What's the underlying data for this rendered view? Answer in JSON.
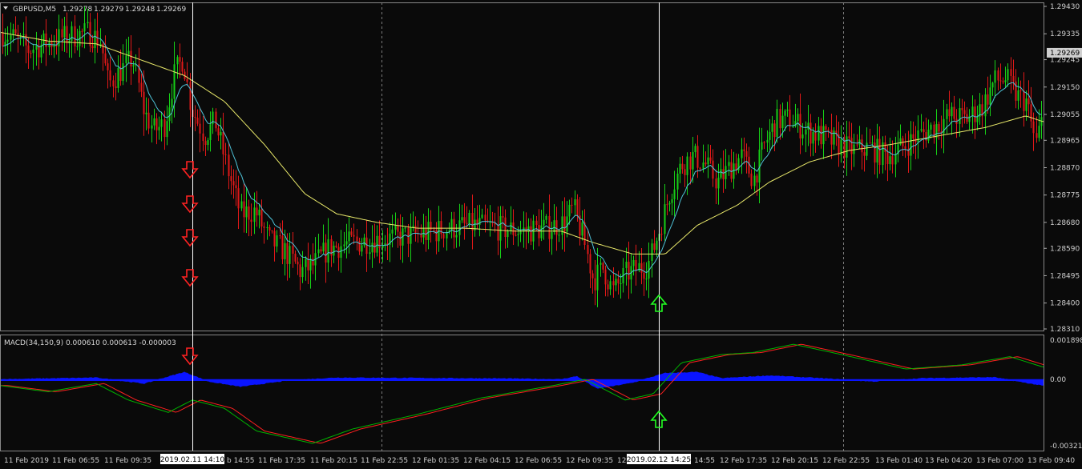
{
  "chart_data": {
    "type": "candlestick",
    "header": {
      "symbol_label": "GBPUSD,M5",
      "ohlc": [
        "1.29278",
        "1.29279",
        "1.29248",
        "1.29269"
      ],
      "current_price": "1.29269"
    },
    "price_axis": {
      "ylim": [
        1.2831,
        1.2943
      ],
      "ticks": [
        "1.29430",
        "1.29335",
        "1.29245",
        "1.29150",
        "1.29055",
        "1.28965",
        "1.28870",
        "1.28775",
        "1.28680",
        "1.28590",
        "1.28495",
        "1.28400",
        "1.28310"
      ]
    },
    "time_labels": [
      "11 Feb 2019",
      "11 Feb 06:55",
      "11 Feb 09:35",
      "b 14:55",
      "11 Feb 17:35",
      "11 Feb 20:15",
      "11 Feb 22:55",
      "12 Feb 01:35",
      "12 Feb 04:15",
      "12 Feb 06:55",
      "12 Feb 09:35",
      "12",
      "14:55",
      "12 Feb 17:35",
      "12 Feb 20:15",
      "12 Feb 22:55",
      "13 Feb 01:40",
      "13 Feb 04:20",
      "13 Feb 07:00",
      "13 Feb 09:40"
    ],
    "time_marks": [
      "2019.02.11 14:10",
      "2019.02.12 14:25"
    ],
    "price_keypoints": [
      [
        0,
        1.2934
      ],
      [
        18,
        1.2932
      ],
      [
        35,
        1.2928
      ],
      [
        55,
        1.293
      ],
      [
        75,
        1.2932
      ],
      [
        95,
        1.2933
      ],
      [
        110,
        1.2934
      ],
      [
        125,
        1.2931
      ],
      [
        135,
        1.2916
      ],
      [
        148,
        1.292
      ],
      [
        165,
        1.2925
      ],
      [
        180,
        1.2906
      ],
      [
        192,
        1.29
      ],
      [
        205,
        1.2902
      ],
      [
        218,
        1.292
      ],
      [
        228,
        1.2925
      ],
      [
        238,
        1.2908
      ],
      [
        255,
        1.2898
      ],
      [
        268,
        1.2903
      ],
      [
        285,
        1.2885
      ],
      [
        300,
        1.2871
      ],
      [
        318,
        1.2872
      ],
      [
        335,
        1.2862
      ],
      [
        355,
        1.2858
      ],
      [
        375,
        1.2851
      ],
      [
        390,
        1.2853
      ],
      [
        410,
        1.2859
      ],
      [
        440,
        1.2861
      ],
      [
        470,
        1.2862
      ],
      [
        500,
        1.2863
      ],
      [
        530,
        1.2864
      ],
      [
        560,
        1.2866
      ],
      [
        590,
        1.2867
      ],
      [
        620,
        1.2866
      ],
      [
        650,
        1.2865
      ],
      [
        680,
        1.2866
      ],
      [
        705,
        1.2868
      ],
      [
        715,
        1.2873
      ],
      [
        728,
        1.2862
      ],
      [
        740,
        1.2848
      ],
      [
        752,
        1.2852
      ],
      [
        765,
        1.2844
      ],
      [
        780,
        1.285
      ],
      [
        795,
        1.2852
      ],
      [
        808,
        1.2853
      ],
      [
        822,
        1.2865
      ],
      [
        835,
        1.2878
      ],
      [
        850,
        1.2888
      ],
      [
        865,
        1.2891
      ],
      [
        880,
        1.2888
      ],
      [
        895,
        1.2882
      ],
      [
        910,
        1.2887
      ],
      [
        925,
        1.2891
      ],
      [
        940,
        1.2883
      ],
      [
        955,
        1.2896
      ],
      [
        968,
        1.2903
      ],
      [
        985,
        1.2904
      ],
      [
        1005,
        1.29
      ],
      [
        1025,
        1.2898
      ],
      [
        1045,
        1.2895
      ],
      [
        1065,
        1.2893
      ],
      [
        1085,
        1.2894
      ],
      [
        1105,
        1.2891
      ],
      [
        1125,
        1.2894
      ],
      [
        1145,
        1.2898
      ],
      [
        1165,
        1.2901
      ],
      [
        1185,
        1.2905
      ],
      [
        1205,
        1.2904
      ],
      [
        1225,
        1.2908
      ],
      [
        1240,
        1.2917
      ],
      [
        1255,
        1.2918
      ],
      [
        1268,
        1.2912
      ],
      [
        1280,
        1.291
      ],
      [
        1292,
        1.2895
      ],
      [
        1301,
        1.2905
      ]
    ],
    "slow_ma_keypoints": [
      [
        0,
        1.2934
      ],
      [
        60,
        1.2931
      ],
      [
        120,
        1.293
      ],
      [
        170,
        1.2925
      ],
      [
        230,
        1.2919
      ],
      [
        280,
        1.291
      ],
      [
        330,
        1.2895
      ],
      [
        380,
        1.2878
      ],
      [
        420,
        1.2871
      ],
      [
        470,
        1.2868
      ],
      [
        520,
        1.2866
      ],
      [
        580,
        1.2866
      ],
      [
        640,
        1.2865
      ],
      [
        700,
        1.2865
      ],
      [
        740,
        1.2861
      ],
      [
        790,
        1.2857
      ],
      [
        830,
        1.2857
      ],
      [
        870,
        1.2867
      ],
      [
        920,
        1.2874
      ],
      [
        960,
        1.2882
      ],
      [
        1010,
        1.2889
      ],
      [
        1060,
        1.2893
      ],
      [
        1110,
        1.2895
      ],
      [
        1170,
        1.2898
      ],
      [
        1230,
        1.2901
      ],
      [
        1280,
        1.2905
      ],
      [
        1301,
        1.2903
      ]
    ],
    "macd": {
      "label": "MACD(34,150,9) 0.000610 0.000613 -0.000003",
      "ylim": [
        -0.003215,
        0.001898
      ],
      "ticks": [
        "0.001898",
        "0.00",
        "-0.003215"
      ],
      "zero_tick": "0.00",
      "main_keypoints": [
        [
          0,
          -0.0003
        ],
        [
          60,
          -0.0006
        ],
        [
          120,
          -0.0002
        ],
        [
          160,
          -0.001
        ],
        [
          210,
          -0.0016
        ],
        [
          240,
          -0.001
        ],
        [
          280,
          -0.0014
        ],
        [
          320,
          -0.0025
        ],
        [
          390,
          -0.0031
        ],
        [
          440,
          -0.0024
        ],
        [
          520,
          -0.0017
        ],
        [
          600,
          -0.0009
        ],
        [
          690,
          -0.0003
        ],
        [
          730,
          0.0
        ],
        [
          780,
          -0.001
        ],
        [
          815,
          -0.0007
        ],
        [
          850,
          0.0008
        ],
        [
          900,
          0.0012
        ],
        [
          940,
          0.0013
        ],
        [
          990,
          0.0017
        ],
        [
          1050,
          0.0012
        ],
        [
          1130,
          0.0005
        ],
        [
          1200,
          0.0007
        ],
        [
          1260,
          0.0011
        ],
        [
          1301,
          0.0006
        ]
      ],
      "histogram_keypoints": [
        [
          0,
          0.0
        ],
        [
          120,
          8e-05
        ],
        [
          180,
          -0.0002
        ],
        [
          230,
          0.00035
        ],
        [
          260,
          -0.0001
        ],
        [
          300,
          -0.00035
        ],
        [
          360,
          -5e-05
        ],
        [
          420,
          8e-05
        ],
        [
          520,
          6e-05
        ],
        [
          620,
          4e-05
        ],
        [
          700,
          0.0
        ],
        [
          720,
          0.00015
        ],
        [
          745,
          -0.00045
        ],
        [
          790,
          -0.00015
        ],
        [
          830,
          0.0003
        ],
        [
          870,
          0.00035
        ],
        [
          900,
          5e-05
        ],
        [
          960,
          0.00018
        ],
        [
          1010,
          8e-05
        ],
        [
          1090,
          -0.0001
        ],
        [
          1150,
          5e-05
        ],
        [
          1240,
          0.0001
        ],
        [
          1301,
          -0.0003
        ]
      ],
      "colors": {
        "main": "#00b400",
        "signal": "#ff2020",
        "histogram": "#0a14ff"
      }
    },
    "markers": [
      {
        "type": "sell-arrow",
        "x_mark": 0,
        "panel": "price",
        "count": 4
      },
      {
        "type": "sell-arrow",
        "x_mark": 0,
        "panel": "macd",
        "count": 1
      },
      {
        "type": "buy-arrow",
        "x_mark": 1,
        "panel": "price",
        "count": 1
      },
      {
        "type": "buy-arrow",
        "x_mark": 1,
        "panel": "macd",
        "count": 1
      }
    ],
    "colors": {
      "background": "#0a0a0a",
      "bull": "#17d017",
      "bear": "#e01818",
      "fast_ma": "#4fc3d8",
      "slow_ma": "#e8e86a",
      "sell_arrow": "#ff2222",
      "buy_arrow": "#22ff22",
      "grid": "#7a7a7a"
    }
  }
}
